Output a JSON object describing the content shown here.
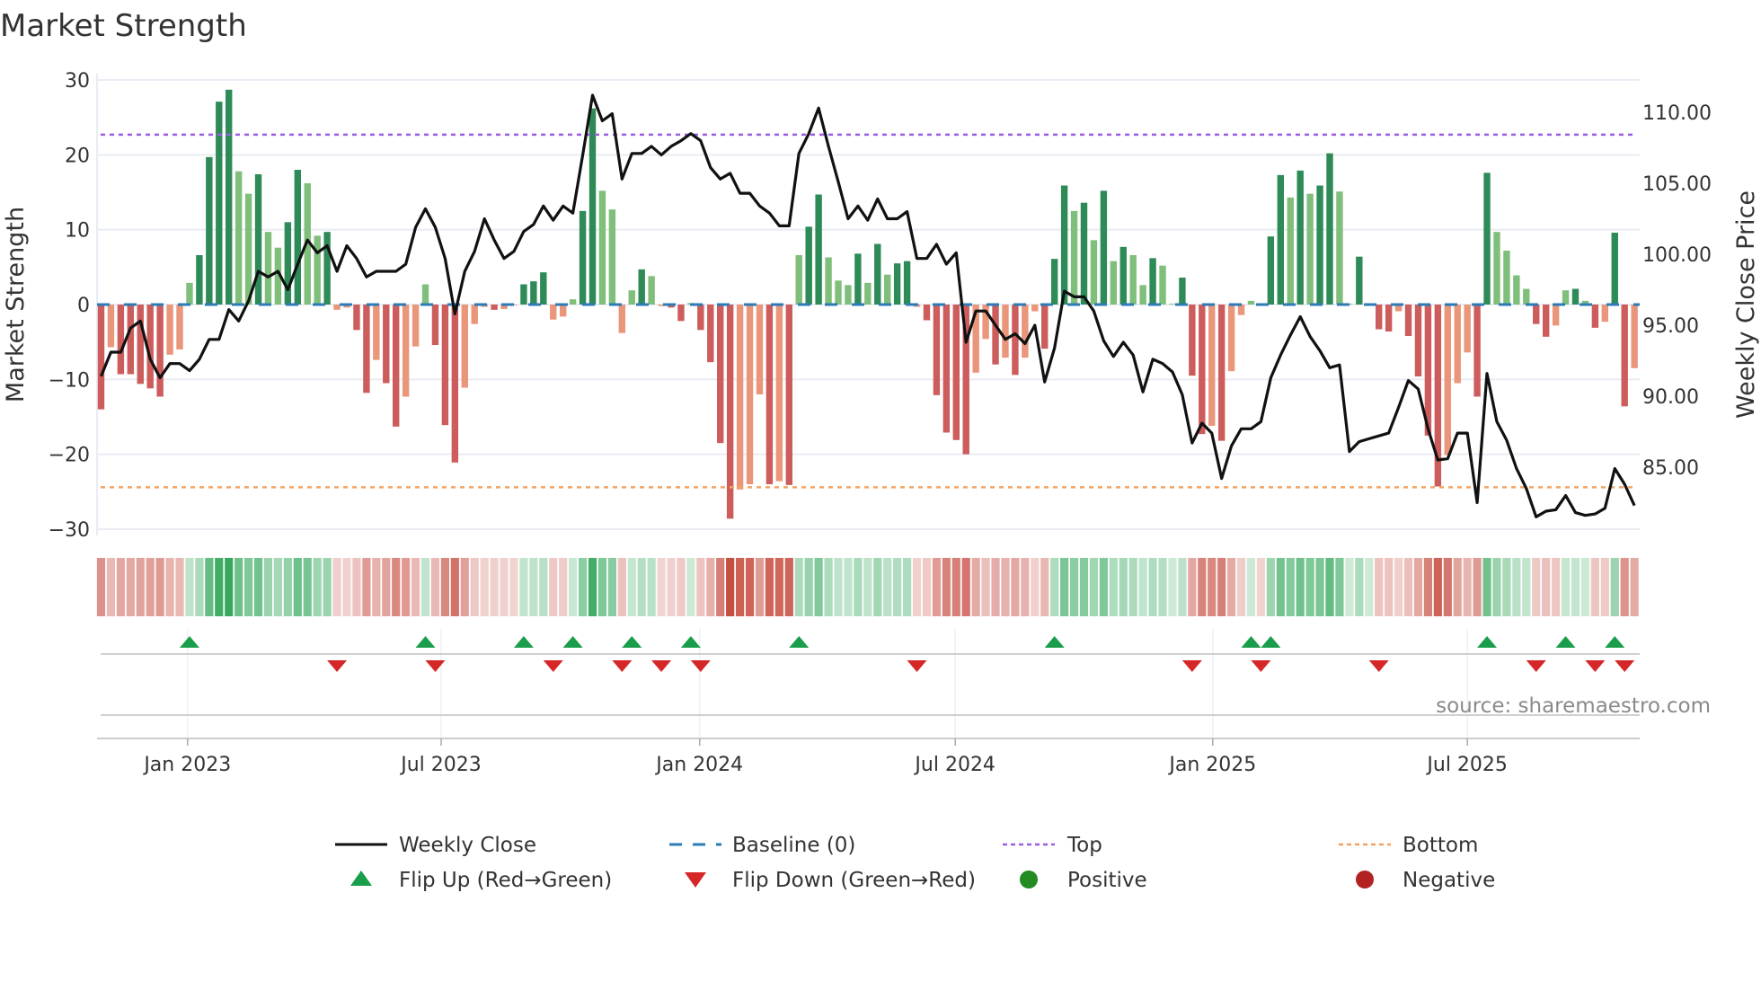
{
  "chart_data": {
    "type": "bar",
    "title": "Market Strength",
    "ylabel": "Market Strength",
    "y2label": "Weekly Close Price",
    "ylim": [
      -30,
      30
    ],
    "y2lim": [
      80.6,
      112.3
    ],
    "yticks": [
      "30",
      "20",
      "10",
      "0",
      "−10",
      "−20",
      "−30"
    ],
    "ytick_values": [
      30,
      20,
      10,
      0,
      -10,
      -20,
      -30
    ],
    "y2ticks": [
      "110.00",
      "105.00",
      "100.00",
      "95.00",
      "90.00",
      "85.00"
    ],
    "y2tick_values": [
      110,
      105,
      100,
      95,
      90,
      85
    ],
    "xticks": [
      "Jan 2023",
      "Jul 2023",
      "Jan 2024",
      "Jul 2024",
      "Jan 2025",
      "Jul 2025"
    ],
    "xtick_week_index": [
      8.8,
      34.6,
      60.9,
      86.9,
      113.1,
      139.0
    ],
    "grid": true,
    "top_level": 22.7,
    "bottom_level": -24.4,
    "baseline": 0,
    "strength": [
      -14.0,
      -5.7,
      -9.3,
      -9.3,
      -10.6,
      -11.2,
      -12.3,
      -6.7,
      -6.0,
      2.9,
      6.6,
      19.7,
      27.1,
      28.7,
      17.8,
      14.8,
      17.4,
      9.7,
      7.6,
      11.0,
      18.0,
      16.2,
      9.2,
      9.7,
      -0.7,
      -0.4,
      -3.4,
      -11.8,
      -7.4,
      -10.5,
      -16.3,
      -12.3,
      -5.6,
      2.7,
      -5.4,
      -16.1,
      -21.1,
      -11.1,
      -2.6,
      -0.3,
      -0.7,
      -0.6,
      -0.1,
      2.7,
      3.1,
      4.3,
      -2.0,
      -1.6,
      0.7,
      12.5,
      26.2,
      15.2,
      12.7,
      -3.8,
      1.9,
      4.7,
      3.8,
      -0.2,
      -0.4,
      -2.2,
      0.2,
      -3.4,
      -7.7,
      -18.5,
      -28.6,
      -24.7,
      -24.0,
      -12.0,
      -24.0,
      -23.6,
      -24.1,
      6.6,
      10.4,
      14.7,
      6.3,
      3.2,
      2.6,
      6.8,
      2.9,
      8.1,
      4.0,
      5.5,
      5.8,
      -0.3,
      -2.1,
      -12.1,
      -17.1,
      -18.1,
      -20.0,
      -9.1,
      -4.6,
      -8.0,
      -7.1,
      -9.4,
      -7.1,
      -0.9,
      -5.9,
      6.1,
      15.9,
      12.5,
      13.6,
      8.6,
      15.2,
      5.8,
      7.7,
      6.6,
      2.6,
      6.2,
      5.2,
      0.1,
      3.6,
      -9.5,
      -17.3,
      -16.2,
      -18.2,
      -8.9,
      -1.4,
      0.5,
      -0.1,
      9.1,
      17.3,
      14.3,
      17.9,
      14.8,
      15.9,
      20.2,
      15.1,
      0.1,
      6.4,
      0.1,
      -3.3,
      -3.6,
      -0.9,
      -4.2,
      -9.6,
      -17.5,
      -24.3,
      -20.1,
      -10.5,
      -6.4,
      -12.3,
      17.6,
      9.7,
      7.2,
      3.9,
      2.1,
      -2.6,
      -4.3,
      -2.8,
      1.9,
      2.1,
      0.5,
      -3.1,
      -2.3,
      9.6,
      -13.6,
      -8.5
    ],
    "weekly_close": [
      91.4,
      93.1,
      93.1,
      94.8,
      95.3,
      92.6,
      91.3,
      92.3,
      92.3,
      91.8,
      92.6,
      94.0,
      94.0,
      96.1,
      95.3,
      96.7,
      98.8,
      98.4,
      98.8,
      97.5,
      99.3,
      101.0,
      100.1,
      100.6,
      98.8,
      100.6,
      99.7,
      98.4,
      98.8,
      98.8,
      98.8,
      99.3,
      101.9,
      103.2,
      101.9,
      99.7,
      95.8,
      98.8,
      100.2,
      102.5,
      101.0,
      99.7,
      100.2,
      101.6,
      102.1,
      103.4,
      102.4,
      103.4,
      102.9,
      107.0,
      111.2,
      109.4,
      109.9,
      105.3,
      107.1,
      107.1,
      107.6,
      107.0,
      107.6,
      108.0,
      108.5,
      108.0,
      106.1,
      105.3,
      105.7,
      104.3,
      104.3,
      103.4,
      102.9,
      102.0,
      102.0,
      107.1,
      108.5,
      110.3,
      107.6,
      105.1,
      102.5,
      103.4,
      102.4,
      103.9,
      102.5,
      102.5,
      103.0,
      99.7,
      99.7,
      100.7,
      99.3,
      100.1,
      93.8,
      96.0,
      96.0,
      95.0,
      94.0,
      94.4,
      93.7,
      95.0,
      91.0,
      93.4,
      97.4,
      97.0,
      97.0,
      96.0,
      93.9,
      92.8,
      93.8,
      92.9,
      90.3,
      92.6,
      92.3,
      91.7,
      90.1,
      86.7,
      88.1,
      87.4,
      84.2,
      86.5,
      87.7,
      87.7,
      88.2,
      91.3,
      92.9,
      94.3,
      95.6,
      94.2,
      93.2,
      92.0,
      92.2,
      86.1,
      86.8,
      87.0,
      87.2,
      87.4,
      89.2,
      91.1,
      90.5,
      87.7,
      85.5,
      85.6,
      87.4,
      87.4,
      82.5,
      91.6,
      88.2,
      86.9,
      84.9,
      83.5,
      81.5,
      81.9,
      82.0,
      83.0,
      81.8,
      81.6,
      81.7,
      82.1,
      84.9,
      83.8,
      82.3
    ],
    "legend": {
      "placement": "bottom",
      "items": [
        {
          "label": "Weekly Close",
          "kind": "line"
        },
        {
          "label": "Baseline (0)",
          "kind": "dash"
        },
        {
          "label": "Top",
          "kind": "dot"
        },
        {
          "label": "Bottom",
          "kind": "dot"
        },
        {
          "label": "Flip Up (Red→Green)",
          "kind": "up"
        },
        {
          "label": "Flip Down (Green→Red)",
          "kind": "down"
        },
        {
          "label": "Positive",
          "kind": "circle"
        },
        {
          "label": "Negative",
          "kind": "circle"
        }
      ]
    },
    "source": "source: sharemaestro.com"
  },
  "colors": {
    "pos_strong": "#2e8b57",
    "pos_weak": "#7fbf7b",
    "neg_strong": "#cd5c5c",
    "neg_weak": "#e9967a",
    "line": "#111111",
    "baseline": "#2c7bb6",
    "top": "#9b5de5",
    "bottom": "#f4a261",
    "flip_up": "#1a9e4b",
    "flip_down": "#d62728",
    "positive": "#228b22",
    "negative": "#b22222",
    "grid": "#e9ecf3"
  }
}
